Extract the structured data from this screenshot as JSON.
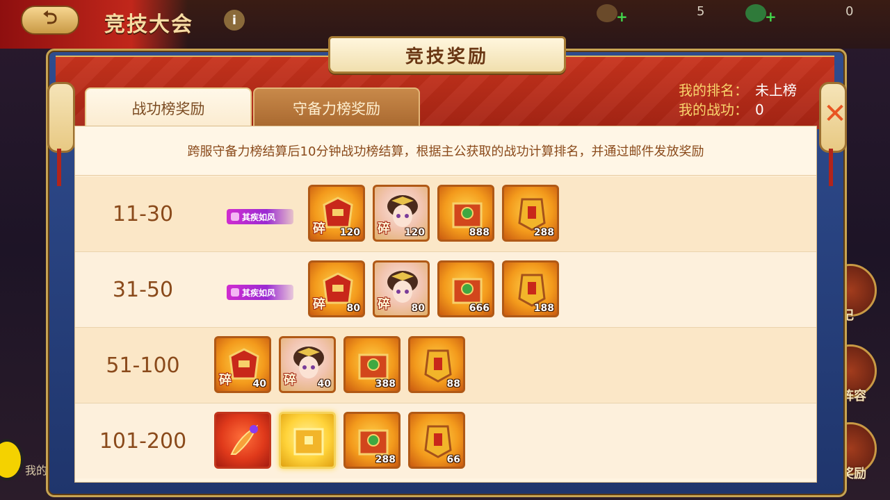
{
  "background": {
    "page_title": "竞技大会",
    "back_icon": "back-arrow-icon",
    "info_icon": "info-icon",
    "info_glyph": "i",
    "resources": [
      {
        "icon": "horse-icon",
        "value": "5"
      },
      {
        "icon": "turtle-icon",
        "value": "0"
      }
    ],
    "side_labels": [
      "战记",
      "守阵容",
      "奖励"
    ],
    "left_label": "我的"
  },
  "modal": {
    "title": "竞技奖励",
    "close_icon": "close-icon",
    "close_glyph": "✕",
    "tabs": [
      {
        "label": "战功榜奖励",
        "active": true
      },
      {
        "label": "守备力榜奖励",
        "active": false
      }
    ],
    "my_rank_label": "我的排名：",
    "my_rank_value": "未上榜",
    "my_merit_label": "我的战功：",
    "my_merit_value": "0",
    "description": "跨服守备力榜结算后10分钟战功榜结算，根据主公获取的战功计算排名，并通过邮件发放奖励",
    "rows": [
      {
        "rank": "11-30",
        "badge": "其疾如风",
        "items": [
          {
            "icon": "armor-shard-icon",
            "count": "120",
            "shard": "碎"
          },
          {
            "icon": "hero-portrait-shard-icon",
            "count": "120",
            "shard": "碎"
          },
          {
            "icon": "treasure-box-icon",
            "count": "888"
          },
          {
            "icon": "command-token-icon",
            "count": "288"
          }
        ]
      },
      {
        "rank": "31-50",
        "badge": "其疾如风",
        "items": [
          {
            "icon": "armor-shard-icon",
            "count": "80",
            "shard": "碎"
          },
          {
            "icon": "hero-portrait-shard-icon",
            "count": "80",
            "shard": "碎"
          },
          {
            "icon": "treasure-box-icon",
            "count": "666"
          },
          {
            "icon": "command-token-icon",
            "count": "188"
          }
        ]
      },
      {
        "rank": "51-100",
        "items": [
          {
            "icon": "armor-shard-icon",
            "count": "40",
            "shard": "碎"
          },
          {
            "icon": "hero-portrait-shard-icon",
            "count": "40",
            "shard": "碎"
          },
          {
            "icon": "treasure-box-icon",
            "count": "388"
          },
          {
            "icon": "command-token-icon",
            "count": "88"
          }
        ]
      },
      {
        "rank": "101-200",
        "items": [
          {
            "icon": "phoenix-feather-icon"
          },
          {
            "icon": "golden-chest-icon"
          },
          {
            "icon": "treasure-box-icon",
            "count": "288"
          },
          {
            "icon": "command-token-icon",
            "count": "66"
          }
        ]
      }
    ]
  }
}
